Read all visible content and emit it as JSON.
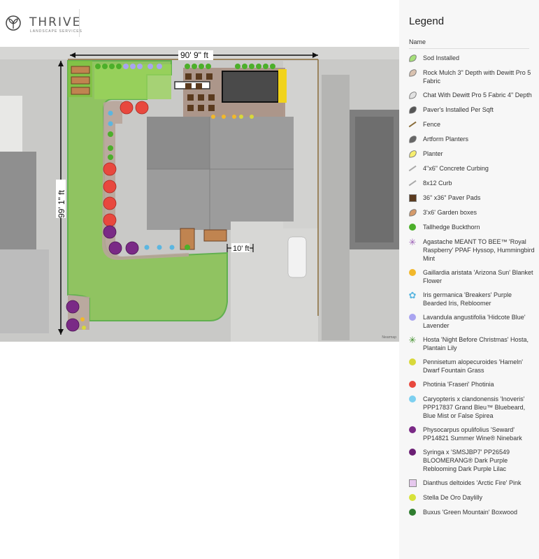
{
  "brand": {
    "name": "THRIVE",
    "tagline": "LANDSCAPE SERVICES"
  },
  "map": {
    "dim_top": "90' 9\" ft",
    "dim_left": "99' 1\" ft",
    "dim_inner": "10' ft",
    "credit": "Nearmap"
  },
  "legend": {
    "title": "Legend",
    "column_header": "Name",
    "items": [
      {
        "label": "Sod Installed",
        "symbol": "leaf",
        "color": "#a6e07a"
      },
      {
        "label": "Rock Mulch 3\" Depth with Dewitt Pro 5 Fabric",
        "symbol": "leaf",
        "color": "#d9c2b0"
      },
      {
        "label": "Chat With Dewitt Pro 5 Fabric 4\" Depth",
        "symbol": "leaf",
        "color": "#e2e2e2"
      },
      {
        "label": "Paver's Installed Per Sqft",
        "symbol": "leaf",
        "color": "#555555"
      },
      {
        "label": "Fence",
        "symbol": "line",
        "color": "#8a6d3b"
      },
      {
        "label": "Artform Planters",
        "symbol": "leaf",
        "color": "#666666"
      },
      {
        "label": "Planter",
        "symbol": "leaf",
        "color": "#f7ee6f"
      },
      {
        "label": "4\"x6\" Concrete Curbing",
        "symbol": "line",
        "color": "#aaaaaa"
      },
      {
        "label": "8x12 Curb",
        "symbol": "line",
        "color": "#aaaaaa"
      },
      {
        "label": "36\" x36\" Paver Pads",
        "symbol": "square",
        "color": "#5a3a1e"
      },
      {
        "label": "3'x6' Garden boxes",
        "symbol": "leaf",
        "color": "#d49a6a"
      },
      {
        "label": "Tallhedge Buckthorn",
        "symbol": "dot",
        "color": "#4caf2a"
      },
      {
        "label": "Agastache MEANT TO BEE™ 'Royal Raspberry' PPAF Hyssop, Hummingbird Mint",
        "symbol": "asterisk",
        "color": "#9b5fb5"
      },
      {
        "label": "Gaillardia aristata 'Arizona Sun' Blanket Flower",
        "symbol": "dot",
        "color": "#f2b82b"
      },
      {
        "label": "Iris germanica 'Breakers' Purple Bearded Iris, Rebloomer",
        "symbol": "flower",
        "color": "#5bb6e0"
      },
      {
        "label": "Lavandula angustifolia 'Hidcote Blue' Lavender",
        "symbol": "dot",
        "color": "#a9a4f0"
      },
      {
        "label": "Hosta 'Night Before Christmas' Hosta, Plantain Lily",
        "symbol": "asterisk",
        "color": "#3f8f2a"
      },
      {
        "label": "Pennisetum alopecuroides 'Hameln' Dwarf Fountain Grass",
        "symbol": "dot",
        "color": "#d8d83a"
      },
      {
        "label": "Photinia 'Fraseri' Photinia",
        "symbol": "dot",
        "color": "#e8483e"
      },
      {
        "label": "Caryopteris x clandonensis 'Inoveris' PPP17837 Grand Bleu™ Bluebeard, Blue Mist or False Spirea",
        "symbol": "dot",
        "color": "#7dd0f0"
      },
      {
        "label": "Physocarpus opulifolius 'Seward' PP14821 Summer Wine® Ninebark",
        "symbol": "dot",
        "color": "#7a2a86"
      },
      {
        "label": "Syringa x 'SMSJBP7' PP26549 BLOOMERANG® Dark Purple Reblooming Dark Purple Lilac",
        "symbol": "dot",
        "color": "#6b1f74"
      },
      {
        "label": "Dianthus deltoides 'Arctic Fire' Pink",
        "symbol": "square",
        "color": "#e6c8ee"
      },
      {
        "label": "Stella De Oro Daylilly",
        "symbol": "dot",
        "color": "#d7e23a"
      },
      {
        "label": "Buxus 'Green Mountain' Boxwood",
        "symbol": "dot",
        "color": "#2f7d2f"
      }
    ]
  }
}
